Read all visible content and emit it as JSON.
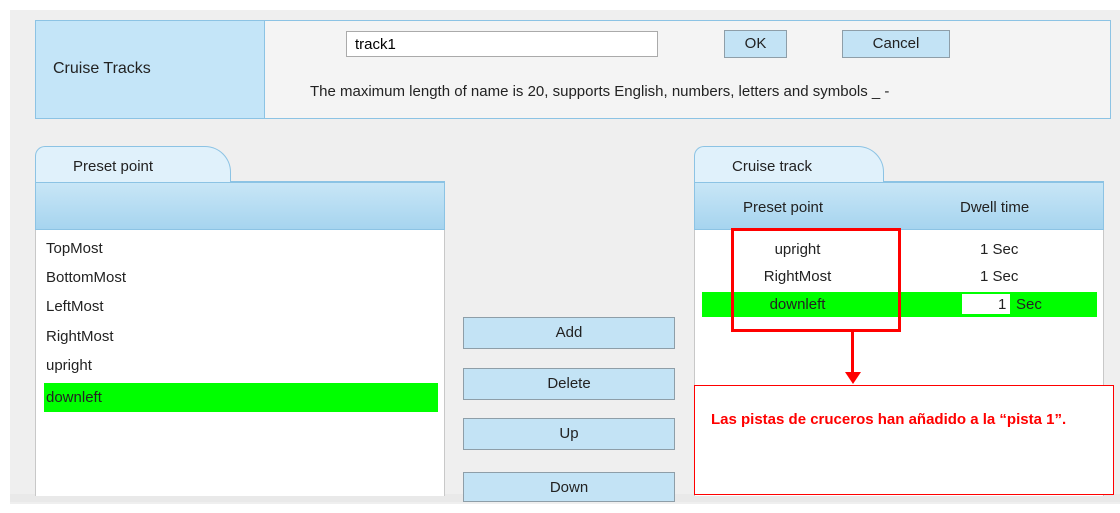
{
  "cruise_tracks": {
    "label": "Cruise Tracks",
    "name_value": "track1",
    "ok_label": "OK",
    "cancel_label": "Cancel",
    "hint": "The maximum length of name is 20, supports English, numbers, letters and symbols _ -"
  },
  "preset_panel": {
    "tab_label": "Preset point",
    "items": [
      "TopMost",
      "BottomMost",
      "LeftMost",
      "RightMost",
      "upright",
      "downleft"
    ],
    "selected": "downleft"
  },
  "actions": {
    "add": "Add",
    "delete": "Delete",
    "up": "Up",
    "down": "Down"
  },
  "track_panel": {
    "tab_label": "Cruise track",
    "col_preset": "Preset point",
    "col_dwell": "Dwell time",
    "rows": [
      {
        "name": "upright",
        "dwell": "1 Sec"
      },
      {
        "name": "RightMost",
        "dwell": "1 Sec"
      },
      {
        "name": "downleft",
        "dwell_value": "1",
        "dwell_unit": "Sec"
      }
    ]
  },
  "annotation": {
    "note": "Las pistas de cruceros han añadido a la “pista 1”."
  },
  "colors": {
    "panel_blue": "#c4e5f8",
    "selection_green": "#00ff00",
    "annotation_red": "#ff0000"
  }
}
